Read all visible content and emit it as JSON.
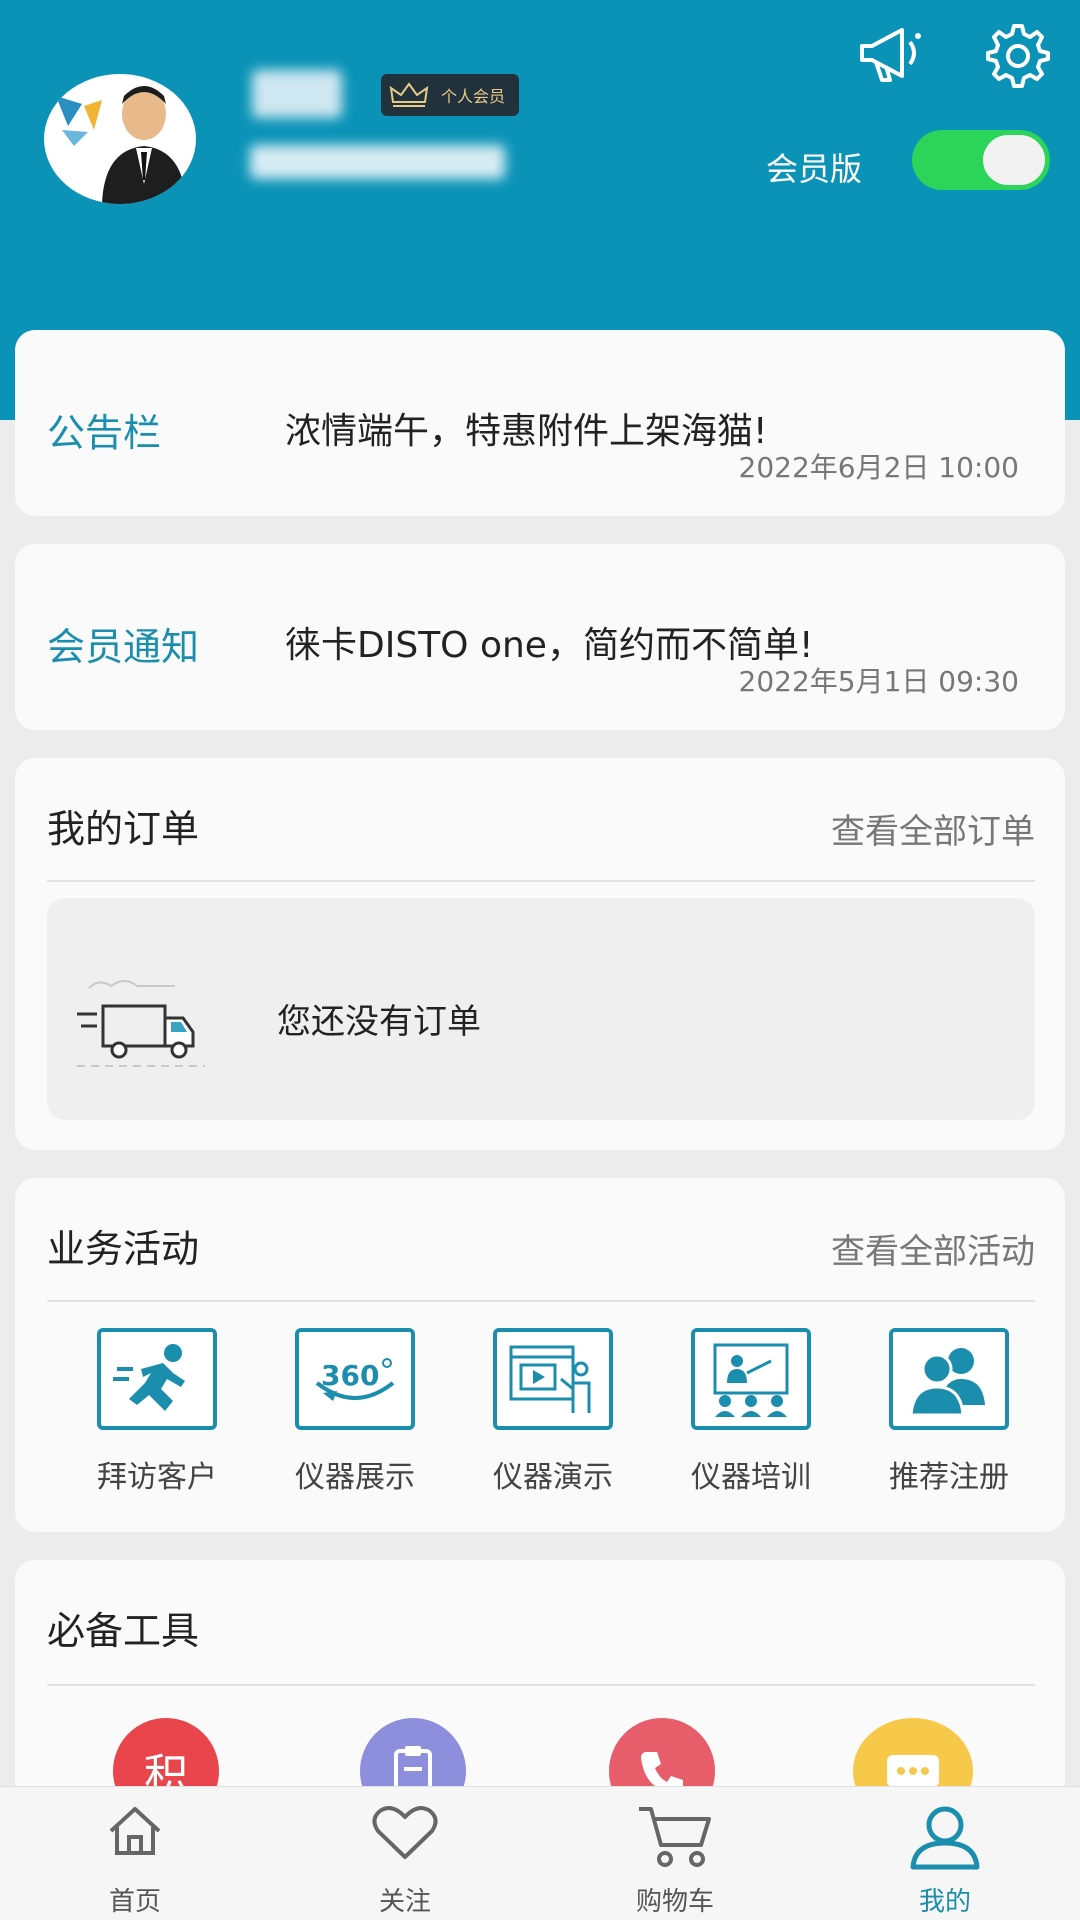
{
  "header": {
    "member_badge": "个人会员",
    "vip_label": "会员版",
    "toggle_on": true
  },
  "bulletin": {
    "title": "公告栏",
    "text": "浓情端午，特惠附件上架海猫!",
    "time": "2022年6月2日 10:00"
  },
  "member_notice": {
    "title": "会员通知",
    "text": "徕卡DISTO one，简约而不简单!",
    "time": "2022年5月1日 09:30"
  },
  "orders": {
    "title": "我的订单",
    "link": "查看全部订单",
    "empty_text": "您还没有订单"
  },
  "activities": {
    "title": "业务活动",
    "link": "查看全部活动",
    "items": [
      {
        "label": "拜访客户",
        "icon": "running-person-icon"
      },
      {
        "label": "仪器展示",
        "icon": "360-view-icon"
      },
      {
        "label": "仪器演示",
        "icon": "presentation-screen-icon"
      },
      {
        "label": "仪器培训",
        "icon": "training-board-icon"
      },
      {
        "label": "推荐注册",
        "icon": "users-icon"
      }
    ]
  },
  "tools": {
    "title": "必备工具",
    "items": [
      {
        "icon_text": "积",
        "color": "#e8464c"
      },
      {
        "icon": "clipboard-icon",
        "color": "#8d8fdc"
      },
      {
        "icon": "phone-icon",
        "color": "#e85d6a"
      },
      {
        "icon": "chat-icon",
        "color": "#f7c94a"
      }
    ]
  },
  "tabbar": {
    "items": [
      {
        "label": "首页",
        "icon": "home-icon"
      },
      {
        "label": "关注",
        "icon": "heart-icon"
      },
      {
        "label": "购物车",
        "icon": "cart-icon"
      },
      {
        "label": "我的",
        "icon": "user-icon",
        "active": true
      }
    ]
  },
  "colors": {
    "header_bg": "#0a93b7",
    "accent": "#1b8ead",
    "toggle_on": "#2cd45a"
  }
}
